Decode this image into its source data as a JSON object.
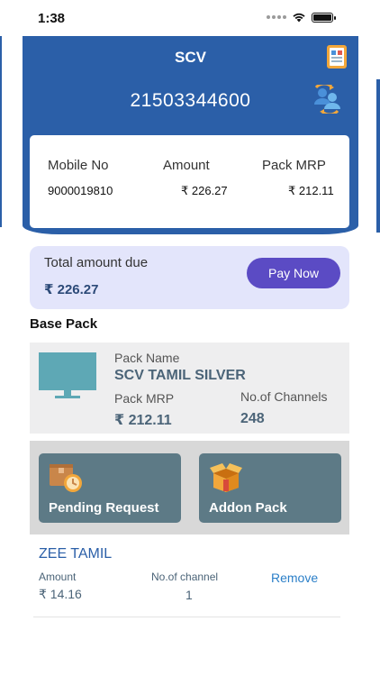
{
  "status_bar": {
    "time": "1:38"
  },
  "header": {
    "title": "SCV"
  },
  "account": {
    "number": "21503344600"
  },
  "info": {
    "mobile_label": "Mobile No",
    "mobile_value": "9000019810",
    "amount_label": "Amount",
    "amount_value": "₹ 226.27",
    "mrp_label": "Pack MRP",
    "mrp_value": "₹ 212.11"
  },
  "due": {
    "label": "Total amount due",
    "amount": "₹ 226.27",
    "pay_button": "Pay Now"
  },
  "base_pack": {
    "section_title": "Base Pack",
    "name_label": "Pack Name",
    "name_value": "SCV TAMIL SILVER",
    "mrp_label": "Pack MRP",
    "mrp_value": "₹ 212.11",
    "channels_label": "No.of Channels",
    "channels_value": "248"
  },
  "tiles": [
    {
      "label": "Pending Request",
      "icon": "pending-request-icon"
    },
    {
      "label": "Addon Pack",
      "icon": "addon-pack-icon"
    }
  ],
  "addon": {
    "name": "ZEE TAMIL",
    "amount_label": "Amount",
    "amount_value": "₹ 14.16",
    "channels_label": "No.of channel",
    "channels_value": "1",
    "remove_label": "Remove"
  },
  "colors": {
    "brand_blue": "#2b5fa8",
    "pay_button": "#5b4bc4",
    "due_bg": "#e3e5fb",
    "tile_bg": "#5d7a86",
    "tv_icon": "#5ea8b5"
  }
}
